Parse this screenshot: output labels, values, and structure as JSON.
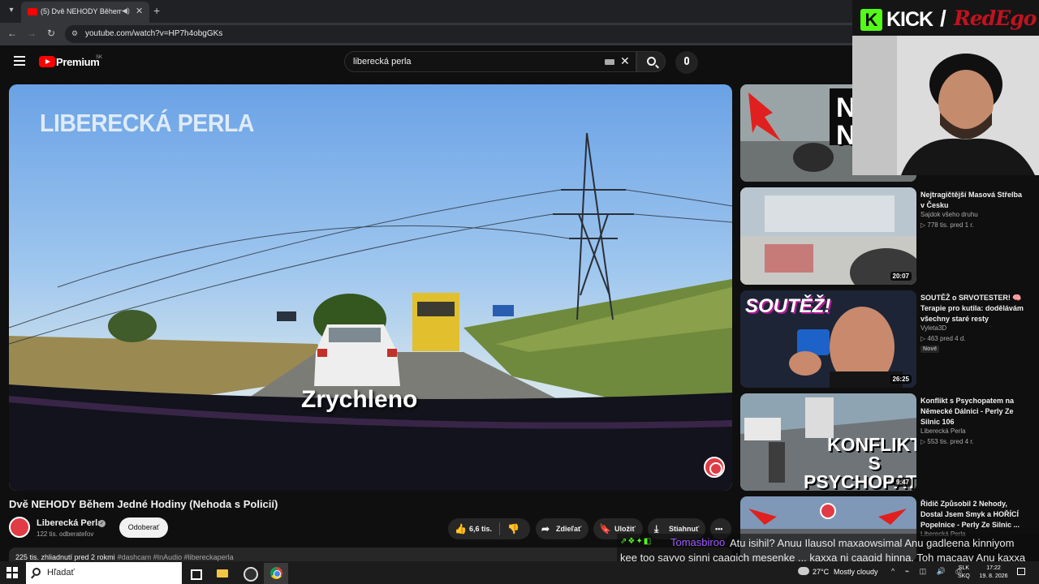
{
  "browser": {
    "tab_title": "(5) Dvě NEHODY Během Jed",
    "url": "youtube.com/watch?v=HP7h4obgGKs"
  },
  "header": {
    "logo_text": "Premium",
    "country_code": "SK",
    "search_query": "liberecká perla"
  },
  "video": {
    "watermark": "LIBERECKÁ PERLA",
    "caption": "Zrychleno",
    "title": "Dvě NEHODY Během Jedné Hodiny (Nehoda s Policií)",
    "channel": "Liberecká Perla",
    "subscribers": "122 tis. odberateľov",
    "subscribe_label": "Odoberať",
    "likes": "6,6 tis.",
    "share_label": "Zdieľať",
    "save_label": "Uložiť",
    "download_label": "Stiahnuť",
    "more_label": "•••",
    "description_meta": "225 tis. zhliadnutí  pred 2 rokmi",
    "description_tags": "#dashcam #InAudio #libereckaperla"
  },
  "sidebar": {
    "items": [
      {
        "duration": "",
        "thumb_text": "N\nNE",
        "title": "",
        "channel": "",
        "meta": ""
      },
      {
        "duration": "20:07",
        "title": "Nejtragičtější Masová Střelba v Česku",
        "channel": "Sajdok všeho druhu",
        "meta": "▷ 778 tis.   pred 1 r."
      },
      {
        "duration": "26:25",
        "thumb_text": "SOUTĚŽ!",
        "title": "SOUTĚŽ o SRVOTESTER! 🧠 Terapie pro kutila: dodělávám všechny staré resty",
        "channel": "Vyleta3D",
        "meta": "▷ 463   pred 4 d.",
        "badge": "Nové"
      },
      {
        "duration": "9:47",
        "thumb_text": "KONFLIKT\nS PSYCHOPATEM",
        "title": "Konflikt s Psychopatem na Německé Dálnici - Perly Ze Silnic 106",
        "channel": "Liberecká Perla",
        "meta": "▷ 553 tis.   pred 4 r."
      },
      {
        "duration": "",
        "title": "Řidič Způsobil 2 Nehody, Dostal Jsem Smyk a HOŘÍCÍ Popelnice - Perly Ze Silnic ...",
        "channel": "Liberecká Perla",
        "meta": ""
      }
    ]
  },
  "overlay": {
    "kick_letter": "K",
    "kick_word": "KICK",
    "slash": "/",
    "streamer_name": "RedEgo"
  },
  "chat": {
    "badges": "⇗❖✦◧",
    "username": "Tomasbiroo",
    "message": "Atu isihil? Anuu Ilausol maxaowsimal Anu gadleena kinniyom kee too sayyo sinni caagich mesenke ... kaxxa ni caagid hinna. Toh macaay Anu kaxxa qokleyna kah liyo"
  },
  "taskbar": {
    "search_placeholder": "Hľadať",
    "temperature": "27°C",
    "weather": "Mostly cloudy",
    "tray": "^ ⌁ ◫ 🔊 ⎙",
    "lang": "SLK",
    "lang2": "SKQ",
    "time": "17:22",
    "date": "19. 8. 2026"
  },
  "colors": {
    "yt_red": "#ff0000",
    "kick_green": "#53fc18",
    "brand_red": "#e13b45"
  }
}
